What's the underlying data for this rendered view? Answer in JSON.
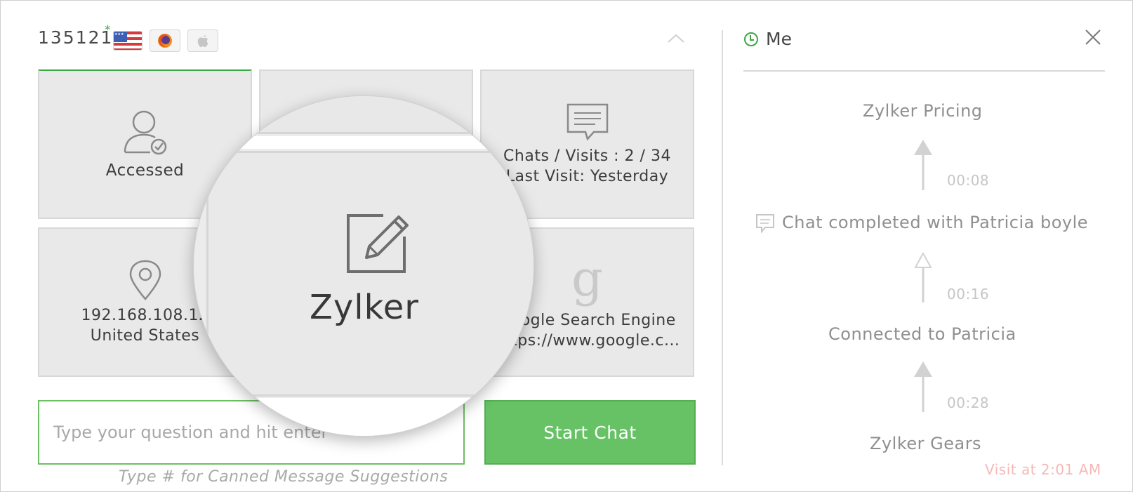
{
  "header": {
    "visitor_id": "135121",
    "visitor_marker": "*",
    "icons": [
      "us-flag-icon",
      "firefox-icon",
      "apple-icon",
      "chevron-up-icon"
    ]
  },
  "tiles": [
    {
      "icon": "user-check-icon",
      "lines": [
        "Accessed"
      ]
    },
    {
      "icon": "blank",
      "lines": []
    },
    {
      "icon": "chat-bubble-icon",
      "lines": [
        "Chats / Visits : 2 / 34",
        "Last Visit: Yesterday"
      ]
    },
    {
      "icon": "map-pin-icon",
      "lines": [
        "192.168.108.12",
        "United States"
      ]
    },
    {
      "icon": "blank",
      "lines": []
    },
    {
      "icon": "google-icon",
      "lines": [
        "Google Search Engine",
        "https://www.google.c..."
      ]
    }
  ],
  "magnifier": {
    "icon": "edit-pencil-icon",
    "label": "Zylker"
  },
  "chat_input": {
    "placeholder": "Type your question and hit enter",
    "button_label": "Start Chat",
    "hint": "Type # for Canned Message Suggestions"
  },
  "right_panel": {
    "owner": "Me",
    "timeline": [
      {
        "type": "page",
        "text": "Zylker Pricing"
      },
      {
        "type": "gap",
        "time": "00:08"
      },
      {
        "type": "chat",
        "text": "Chat completed with Patricia boyle"
      },
      {
        "type": "gap",
        "time": "00:16"
      },
      {
        "type": "page",
        "text": "Connected to Patricia"
      },
      {
        "type": "gap",
        "time": "00:28"
      },
      {
        "type": "page",
        "text": "Zylker Gears"
      }
    ],
    "visit_time": "Visit at 2:01 AM"
  },
  "colors": {
    "accent_green": "#67c165",
    "tile_bg": "#e9e9e9",
    "visit_time": "#f5b8b8"
  }
}
